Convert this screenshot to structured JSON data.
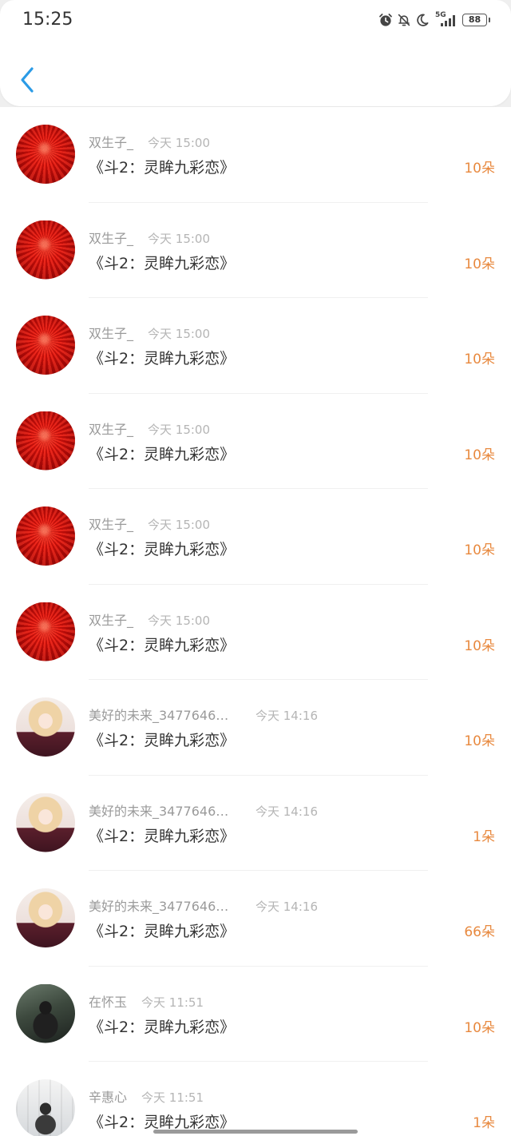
{
  "status_bar": {
    "time": "15:25",
    "network": "5G",
    "battery": "88",
    "icons": [
      "alarm-icon",
      "bell-off-icon",
      "moon-icon",
      "signal-icon",
      "battery-icon"
    ]
  },
  "header": {
    "back_icon": "chevron-left-icon"
  },
  "colors": {
    "accent": "#2b9be6",
    "gift_count": "#e8893f",
    "name": "#9a9a9a",
    "title": "#333333",
    "time": "#b5b5b5"
  },
  "gifts": [
    {
      "name": "双生子_",
      "time": "今天 15:00",
      "title": "《斗2：灵眸九彩恋》",
      "count": "10朵",
      "avatar": "red-spider-lily-photo"
    },
    {
      "name": "双生子_",
      "time": "今天 15:00",
      "title": "《斗2：灵眸九彩恋》",
      "count": "10朵",
      "avatar": "red-spider-lily-photo"
    },
    {
      "name": "双生子_",
      "time": "今天 15:00",
      "title": "《斗2：灵眸九彩恋》",
      "count": "10朵",
      "avatar": "red-spider-lily-photo"
    },
    {
      "name": "双生子_",
      "time": "今天 15:00",
      "title": "《斗2：灵眸九彩恋》",
      "count": "10朵",
      "avatar": "red-spider-lily-photo"
    },
    {
      "name": "双生子_",
      "time": "今天 15:00",
      "title": "《斗2：灵眸九彩恋》",
      "count": "10朵",
      "avatar": "red-spider-lily-photo"
    },
    {
      "name": "双生子_",
      "time": "今天 15:00",
      "title": "《斗2：灵眸九彩恋》",
      "count": "10朵",
      "avatar": "red-spider-lily-photo"
    },
    {
      "name": "美好的未来_3477646…",
      "time": "今天 14:16",
      "title": "《斗2：灵眸九彩恋》",
      "count": "10朵",
      "avatar": "anime-girl-illustration"
    },
    {
      "name": "美好的未来_3477646…",
      "time": "今天 14:16",
      "title": "《斗2：灵眸九彩恋》",
      "count": "1朵",
      "avatar": "anime-girl-illustration"
    },
    {
      "name": "美好的未来_3477646…",
      "time": "今天 14:16",
      "title": "《斗2：灵眸九彩恋》",
      "count": "66朵",
      "avatar": "anime-girl-illustration"
    },
    {
      "name": "在怀玉",
      "time": "今天 11:51",
      "title": "《斗2：灵眸九彩恋》",
      "count": "10朵",
      "avatar": "person-outdoor-photo"
    },
    {
      "name": "辛惠心",
      "time": "今天 11:51",
      "title": "《斗2：灵眸九彩恋》",
      "count": "1朵",
      "avatar": "person-indoor-photo"
    }
  ]
}
